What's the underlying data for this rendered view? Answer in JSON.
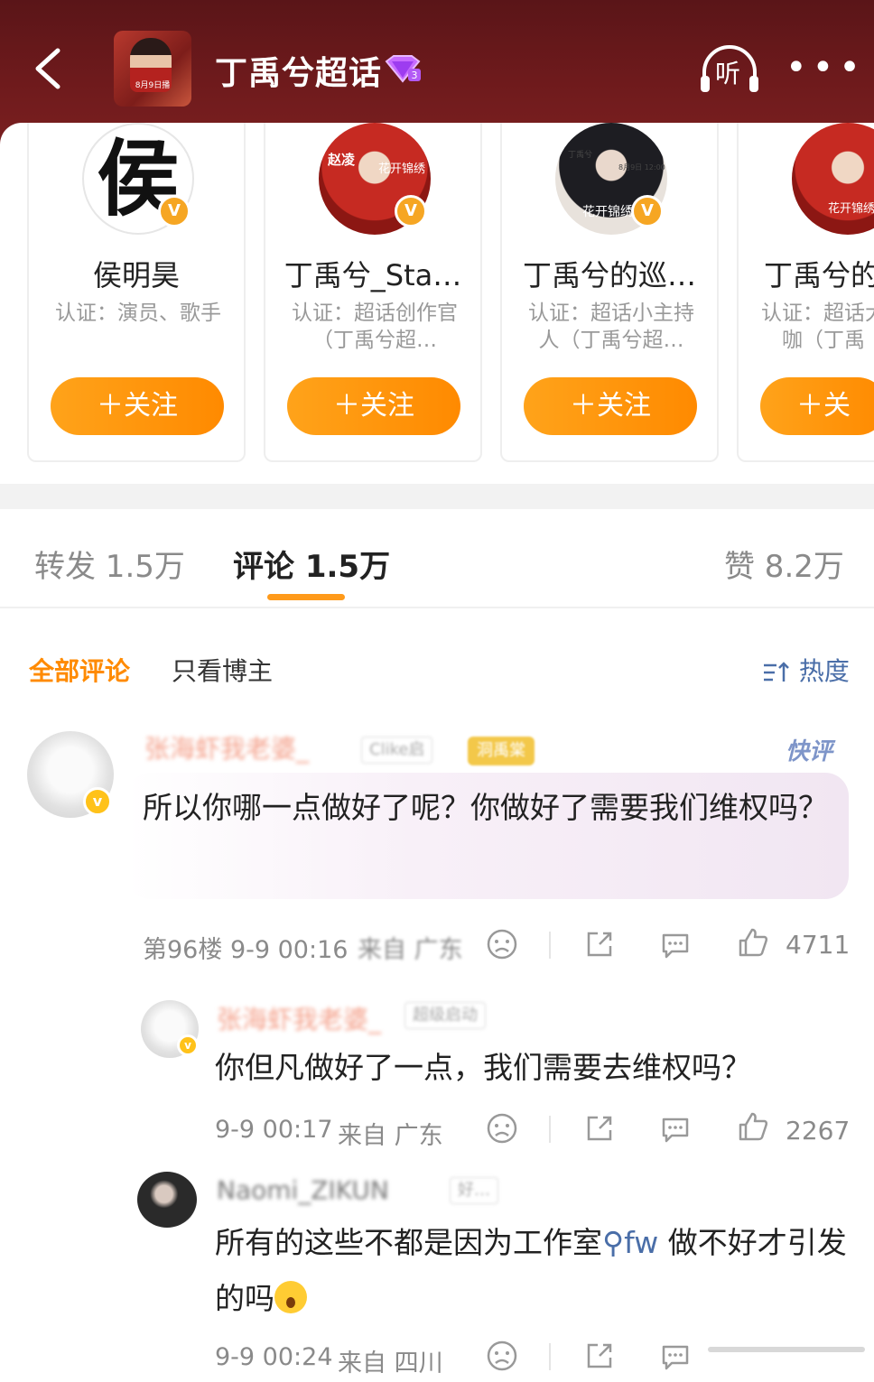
{
  "header": {
    "title": "丁禹兮超话",
    "listen_label": "听",
    "bg_color": "#6b1a1c",
    "cover_texts": [
      "8月9日播"
    ]
  },
  "cards": [
    {
      "name": "侯明昊",
      "desc": "认证：演员、歌手",
      "follow": "＋关注",
      "avatar_char": "侯"
    },
    {
      "name": "丁禹兮_Sta…",
      "desc": "认证：超话创作官（丁禹兮超…",
      "follow": "＋关注",
      "avatar_texts": [
        "赵凌",
        "花开锦绣"
      ]
    },
    {
      "name": "丁禹兮的巡…",
      "desc": "认证：超话小主持人（丁禹兮超…",
      "follow": "＋关注",
      "avatar_texts": [
        "丁禹兮",
        "8月9日 12:00",
        "花开锦绣"
      ]
    },
    {
      "name": "丁禹兮的",
      "desc": "认证：超话大咖（丁禹",
      "follow": "＋关",
      "avatar_texts": [
        "花开锦绣"
      ]
    }
  ],
  "tabs": {
    "repost": "转发 1.5万",
    "comment": "评论 1.5万",
    "like": "赞 8.2万"
  },
  "filters": {
    "all": "全部评论",
    "owner_only": "只看博主",
    "sort": "热度"
  },
  "comments": [
    {
      "user": "张海虾我老婆_",
      "tag": "Clike启",
      "gold_tag": "洞禹棠",
      "badge": "快评",
      "text": "所以你哪一点做好了呢？你做好了需要我们维权吗？",
      "floor_time": "第96楼 9-9 00:16",
      "location": "来自 广东",
      "likes": "4711"
    },
    {
      "user": "张海虾我老婆_",
      "tag": "超级启动",
      "text": "你但凡做好了一点，我们需要去维权吗？",
      "time": "9-9 00:17",
      "location": "来自 广东",
      "likes": "2267"
    },
    {
      "user": "Naomi_ZIKUN",
      "tag": "好…",
      "text_before": "所有的这些不都是因为工作室",
      "link": "fw",
      "text_after": "做不好才引发的吗",
      "time": "9-9 00:24",
      "location": "来自 四川"
    }
  ],
  "colors": {
    "accent": "#ff8a00",
    "link": "#4a6ea8"
  }
}
